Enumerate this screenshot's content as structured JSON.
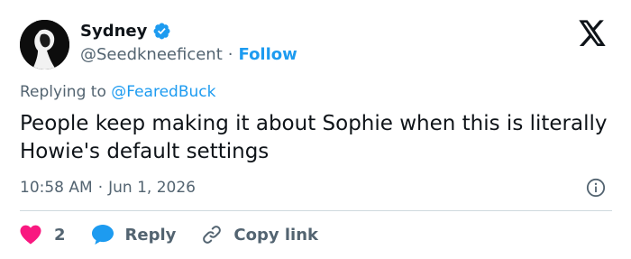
{
  "author": {
    "name": "Sydney",
    "handle": "@Seedkneeficent",
    "separator": "·",
    "follow_label": "Follow"
  },
  "reply_context": {
    "prefix": "Replying to ",
    "mention": "@FearedBuck"
  },
  "tweet": {
    "text": "People keep making it about Sophie when this is literally Howie's default settings",
    "time": "10:58 AM",
    "separator": "·",
    "date": "Jun 1, 2026"
  },
  "actions": {
    "like_count": "2",
    "reply_label": "Reply",
    "copy_label": "Copy link"
  },
  "icons": {
    "logo": "x-logo-icon",
    "verified": "verified-badge-icon",
    "info": "info-icon",
    "like": "heart-icon",
    "reply": "speech-bubble-icon",
    "copy": "link-icon"
  },
  "colors": {
    "accent": "#1d9bf0",
    "like": "#f91880",
    "muted_text": "#536471",
    "text": "#0f1419",
    "divider": "#cfd9de"
  }
}
